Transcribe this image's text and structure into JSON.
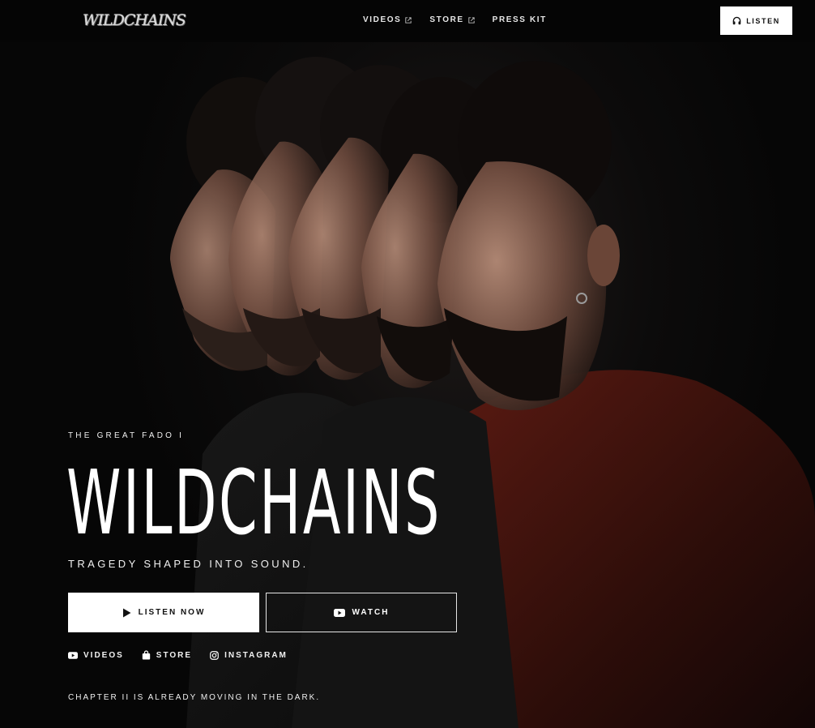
{
  "header": {
    "logo_text": "WILDCHAINS",
    "nav": [
      {
        "label": "VIDEOS",
        "external": true
      },
      {
        "label": "STORE",
        "external": true
      },
      {
        "label": "PRESS KIT",
        "external": false
      }
    ],
    "listen_label": "LISTEN"
  },
  "hero": {
    "kicker": "THE GREAT FADO I",
    "title": "WILDCHAINS",
    "tagline": "TRAGEDY SHAPED INTO SOUND.",
    "listen_now_label": "LISTEN NOW",
    "watch_label": "WATCH",
    "links": [
      {
        "label": "VIDEOS",
        "icon": "youtube-icon"
      },
      {
        "label": "STORE",
        "icon": "shopping-bag-icon"
      },
      {
        "label": "INSTAGRAM",
        "icon": "instagram-icon"
      }
    ],
    "teaser": "CHAPTER II IS ALREADY MOVING IN THE DARK."
  },
  "colors": {
    "background": "#060606",
    "text": "#ffffff",
    "button_fill": "#ffffff",
    "jacket_accent": "#5a1a12"
  }
}
